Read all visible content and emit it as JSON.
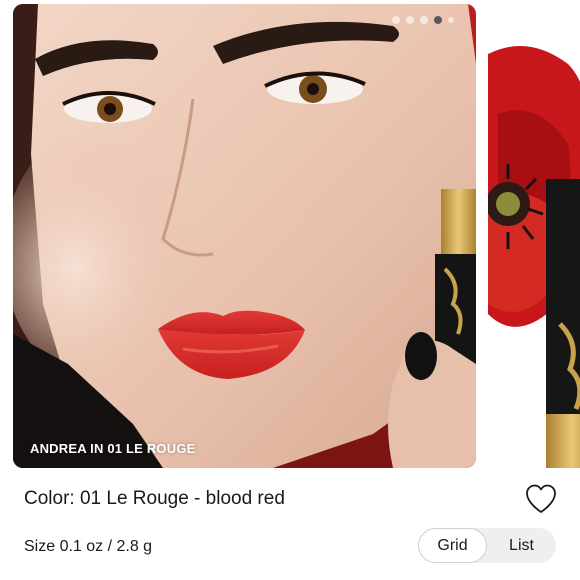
{
  "carousel": {
    "caption": "ANDREA IN 01 LE ROUGE",
    "dots": [
      {
        "active": false
      },
      {
        "active": false
      },
      {
        "active": false
      },
      {
        "active": true
      },
      {
        "active": false
      }
    ]
  },
  "product": {
    "color_label": "Color: 01 Le Rouge - blood red",
    "size_label": "Size 0.1 oz / 2.8 g"
  },
  "view_toggle": {
    "options": [
      "Grid",
      "List"
    ],
    "selected": "Grid"
  },
  "icons": {
    "wishlist": "heart-outline-icon"
  },
  "colors": {
    "lipstick_red": "#d8262b",
    "poppy_red": "#c8171a",
    "gold": "#c9a34c"
  }
}
